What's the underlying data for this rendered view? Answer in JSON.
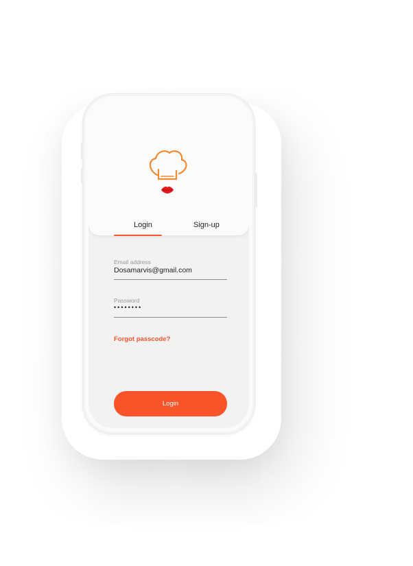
{
  "tabs": {
    "login_label": "Login",
    "signup_label": "Sign-up",
    "active": "login"
  },
  "email": {
    "label": "Email address",
    "value": "Dosamarvis@gmail.com"
  },
  "password": {
    "label": "Password",
    "value": "••••••••"
  },
  "forgot_label": "Forgot passcode?",
  "login_button_label": "Login",
  "icons": {
    "logo": "chef-hat-lips-logo-icon"
  },
  "colors": {
    "accent": "#f7562a",
    "button": "#f9532a",
    "logo_hat": "#f08a2e",
    "logo_lips": "#e01c1c",
    "screen_bg": "#f2f2f3"
  }
}
